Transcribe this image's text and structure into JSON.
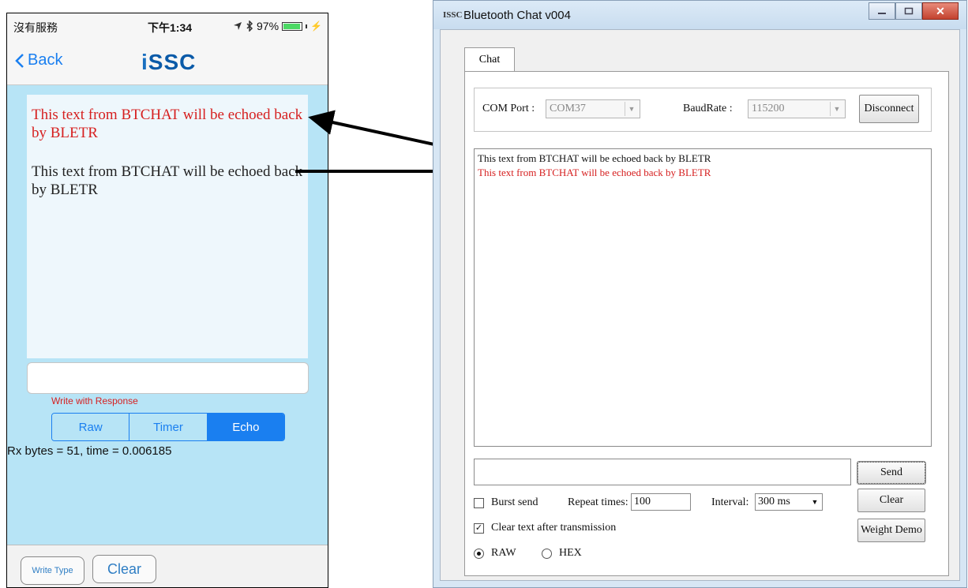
{
  "phone": {
    "status": {
      "carrier": "沒有服務",
      "time": "下午1:34",
      "battery": "97%",
      "battery_level": 0.97
    },
    "nav": {
      "back_label": "Back",
      "logo_i": "i",
      "logo_rest": "SSC"
    },
    "textview": {
      "line_red": "This text from BTCHAT will be echoed back by BLETR",
      "line_black": "This text from BTCHAT will be echoed back by BLETR"
    },
    "input_value": "",
    "write_mode": "Write with Response",
    "segments": [
      {
        "label": "Raw",
        "active": false
      },
      {
        "label": "Timer",
        "active": false
      },
      {
        "label": "Echo",
        "active": true
      }
    ],
    "rx_status": "Rx bytes = 51, time = 0.006185",
    "buttons": {
      "write_type": "Write Type",
      "clear": "Clear"
    }
  },
  "desktop": {
    "window_title": "Bluetooth Chat v004",
    "app_icon": "ISSC",
    "caption_icons": [
      "minimize-icon",
      "maximize-icon",
      "close-icon"
    ],
    "tab": "Chat",
    "com_port": {
      "label": "COM Port :",
      "value": "COM37"
    },
    "baudrate": {
      "label": "BaudRate :",
      "value": "115200"
    },
    "disconnect": "Disconnect",
    "log_lines": [
      {
        "text": "This text from BTCHAT will be echoed back by BLETR",
        "color": "#111111"
      },
      {
        "text": "This text from BTCHAT will be echoed back by BLETR",
        "color": "#d62020"
      }
    ],
    "send_value": "",
    "send": "Send",
    "burst_send": {
      "label": "Burst send",
      "checked": false
    },
    "repeat_times": {
      "label": "Repeat times:",
      "value": "100"
    },
    "interval": {
      "label": "Interval:",
      "value": "300 ms"
    },
    "clear": "Clear",
    "clear_after": {
      "label": "Clear text after transmission",
      "checked": true
    },
    "weight_demo": "Weight Demo",
    "format": {
      "raw": "RAW",
      "hex": "HEX",
      "selected": "RAW"
    }
  },
  "colors": {
    "ios_blue": "#1a7ff0",
    "echo_red": "#d62020",
    "phone_bg": "#b7e4f6"
  }
}
